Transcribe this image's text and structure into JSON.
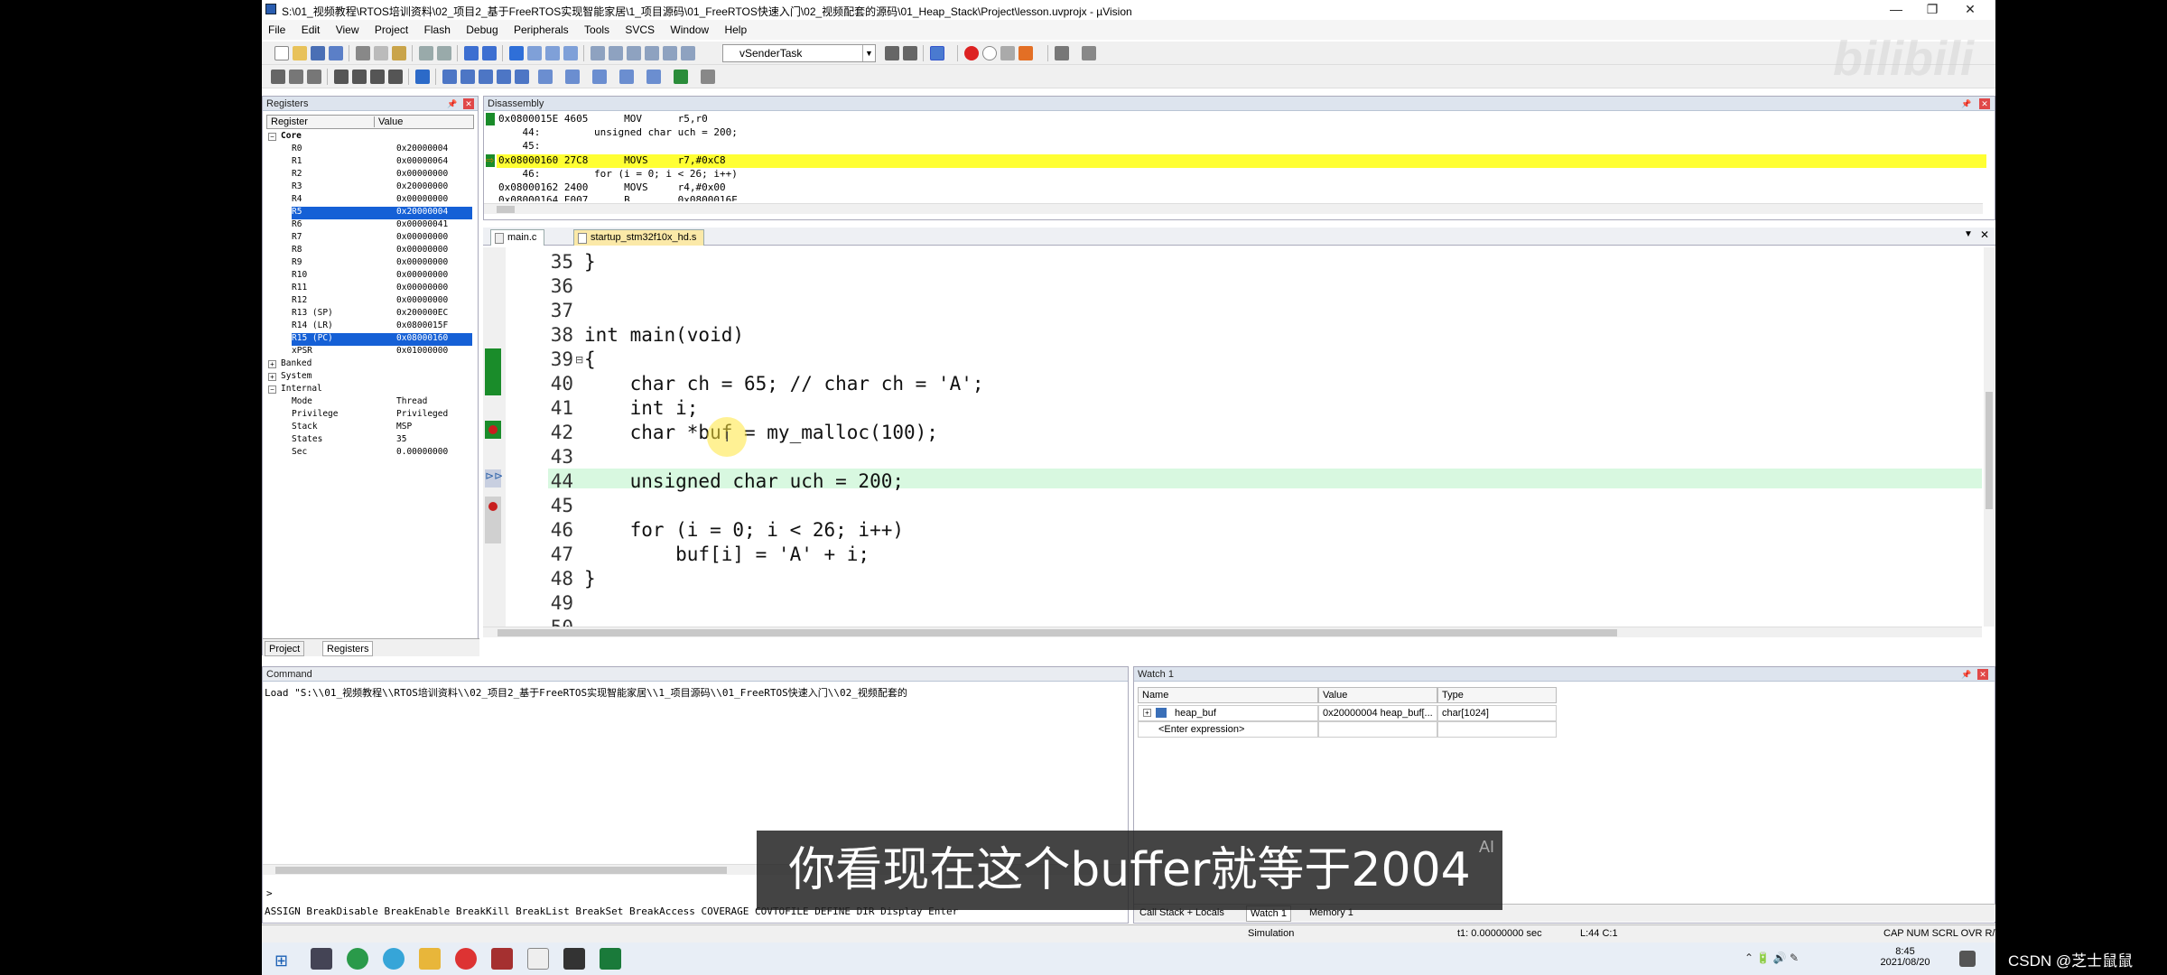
{
  "window": {
    "title": "S:\\01_视频教程\\RTOS培训资料\\02_项目2_基于FreeRTOS实现智能家居\\1_项目源码\\01_FreeRTOS快速入门\\02_视频配套的源码\\01_Heap_Stack\\Project\\lesson.uvprojx - µVision",
    "controls": [
      "—",
      "❐",
      "✕"
    ]
  },
  "menu": [
    "File",
    "Edit",
    "View",
    "Project",
    "Flash",
    "Debug",
    "Peripherals",
    "Tools",
    "SVCS",
    "Window",
    "Help"
  ],
  "toolbar": {
    "target": "vSenderTask"
  },
  "registers": {
    "title": "Registers",
    "col_register": "Register",
    "col_value": "Value",
    "core_label": "Core",
    "rows": [
      {
        "name": "R0",
        "value": "0x20000004"
      },
      {
        "name": "R1",
        "value": "0x00000064"
      },
      {
        "name": "R2",
        "value": "0x00000000"
      },
      {
        "name": "R3",
        "value": "0x20000000"
      },
      {
        "name": "R4",
        "value": "0x00000000"
      },
      {
        "name": "R5",
        "value": "0x20000004"
      },
      {
        "name": "R6",
        "value": "0x00000041"
      },
      {
        "name": "R7",
        "value": "0x00000000"
      },
      {
        "name": "R8",
        "value": "0x00000000"
      },
      {
        "name": "R9",
        "value": "0x00000000"
      },
      {
        "name": "R10",
        "value": "0x00000000"
      },
      {
        "name": "R11",
        "value": "0x00000000"
      },
      {
        "name": "R12",
        "value": "0x00000000"
      },
      {
        "name": "R13 (SP)",
        "value": "0x200000EC"
      },
      {
        "name": "R14 (LR)",
        "value": "0x0800015F"
      },
      {
        "name": "R15 (PC)",
        "value": "0x08000160"
      },
      {
        "name": "xPSR",
        "value": "0x01000000"
      }
    ],
    "groups": [
      "Banked",
      "System",
      "Internal"
    ],
    "internal": [
      {
        "name": "Mode",
        "value": "Thread"
      },
      {
        "name": "Privilege",
        "value": "Privileged"
      },
      {
        "name": "Stack",
        "value": "MSP"
      },
      {
        "name": "States",
        "value": "35"
      },
      {
        "name": "Sec",
        "value": "0.00000000"
      }
    ],
    "tab_project": "Project",
    "tab_registers": "Registers"
  },
  "disassembly": {
    "title": "Disassembly",
    "lines": [
      "0x0800015E 4605      MOV      r5,r0",
      "    44:         unsigned char uch = 200;",
      "    45:",
      "0x08000160 27C8      MOVS     r7,#0xC8",
      "    46:         for (i = 0; i < 26; i++)",
      "0x08000162 2400      MOVS     r4,#0x00",
      "0x08000164 E007      B        0x0800016E"
    ]
  },
  "editor": {
    "tabs": [
      "main.c",
      "startup_stm32f10x_hd.s"
    ],
    "lines": [
      {
        "num": "35",
        "text": "}"
      },
      {
        "num": "36",
        "text": ""
      },
      {
        "num": "37",
        "text": ""
      },
      {
        "num": "38",
        "text": "int main(void)"
      },
      {
        "num": "39",
        "text": "{"
      },
      {
        "num": "40",
        "text": "    char ch = 65; // char ch = 'A';"
      },
      {
        "num": "41",
        "text": "    int i;"
      },
      {
        "num": "42",
        "text": "    char *buf = my_malloc(100);"
      },
      {
        "num": "43",
        "text": ""
      },
      {
        "num": "44",
        "text": "    unsigned char uch = 200;"
      },
      {
        "num": "45",
        "text": ""
      },
      {
        "num": "46",
        "text": "    for (i = 0; i < 26; i++)"
      },
      {
        "num": "47",
        "text": "        buf[i] = 'A' + i;"
      },
      {
        "num": "48",
        "text": "}"
      },
      {
        "num": "49",
        "text": ""
      },
      {
        "num": "50",
        "text": ""
      }
    ]
  },
  "command": {
    "title": "Command",
    "output": "Load \"S:\\\\01_视频教程\\\\RTOS培训资料\\\\02_项目2_基于FreeRTOS实现智能家居\\\\1_项目源码\\\\01_FreeRTOS快速入门\\\\02_视频配套的",
    "prompt": ">",
    "hint": "ASSIGN BreakDisable BreakEnable BreakKill BreakList BreakSet BreakAccess COVERAGE COVTOFILE DEFINE DIR Display Enter"
  },
  "watch": {
    "title": "Watch 1",
    "col_name": "Name",
    "col_value": "Value",
    "col_type": "Type",
    "rows": [
      {
        "name": "heap_buf",
        "value": "0x20000004 heap_buf[...",
        "type": "char[1024]"
      },
      {
        "name": "<Enter expression>",
        "value": "",
        "type": ""
      }
    ],
    "tabs": [
      "Call Stack + Locals",
      "Watch 1",
      "Memory 1"
    ]
  },
  "status": {
    "mode": "Simulation",
    "time": "t1: 0.00000000 sec",
    "position": "L:44 C:1",
    "keys": "CAP  NUM  SCRL  OVR  R/W"
  },
  "taskbar": {
    "time": "8:45",
    "date": "2021/08/20"
  },
  "overlay": {
    "subtitle": "你看现在这个buffer就等于2004",
    "ai_tag": "AI",
    "watermark": "bilibili",
    "credit": "CSDN @芝士鼠鼠"
  },
  "colors": {
    "current_line": "#ffff33",
    "selection": "#1560d6",
    "exec_line": "#d8f8e0"
  }
}
